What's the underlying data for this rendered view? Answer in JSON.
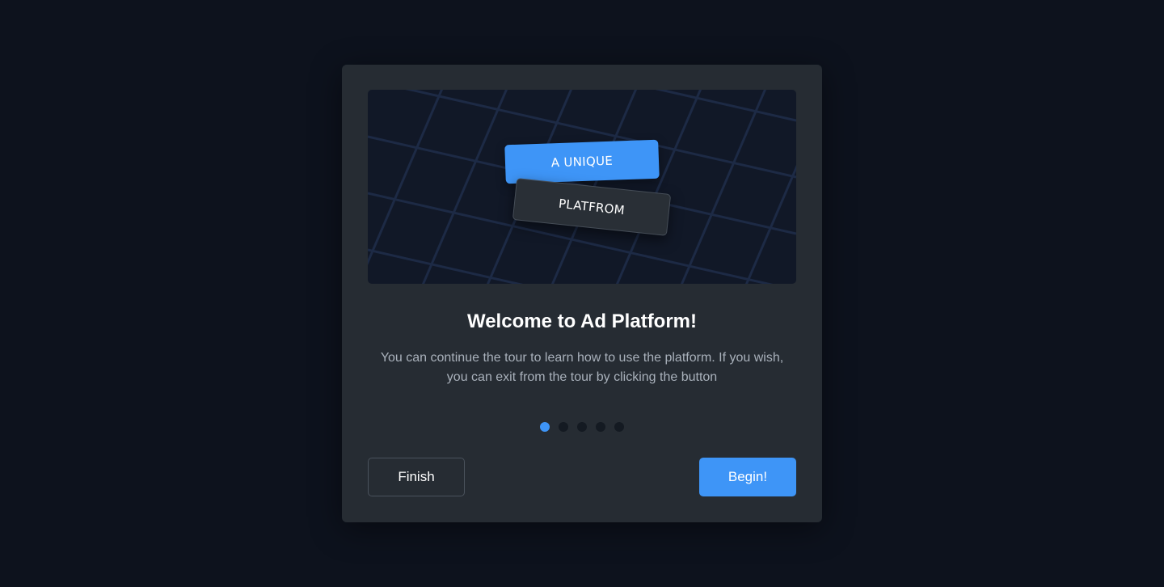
{
  "modal": {
    "hero": {
      "tag_primary": "A UNIQUE",
      "tag_secondary": "PLATFROM"
    },
    "title": "Welcome to Ad Platform!",
    "description": "You can continue the tour to learn how to use the platform. If you wish, you can exit from the tour by clicking the button",
    "pager": {
      "total_steps": 5,
      "current_step": 1
    },
    "buttons": {
      "finish_label": "Finish",
      "begin_label": "Begin!"
    }
  },
  "colors": {
    "background": "#0d121d",
    "modal": "#262c33",
    "accent": "#3e95f7",
    "muted_text": "#a9b1bb"
  }
}
